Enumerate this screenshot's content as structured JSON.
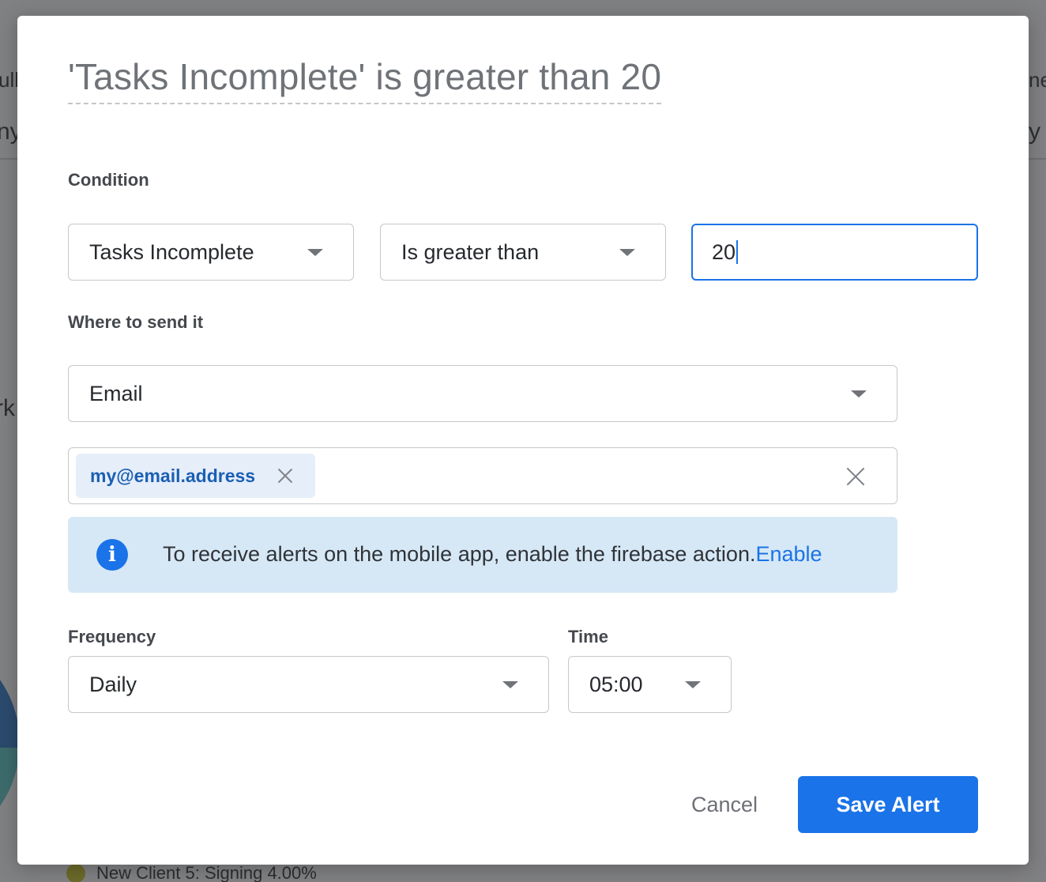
{
  "background": {
    "fragments": [
      "ull",
      "ny",
      "rk",
      "ne",
      "y"
    ],
    "legend_item": "New Client 5: Signing 4.00%"
  },
  "dialog": {
    "title": "'Tasks Incomplete' is greater than 20",
    "condition": {
      "label": "Condition",
      "metric_value": "Tasks Incomplete",
      "operator_value": "Is greater than",
      "threshold_value": "20"
    },
    "destination": {
      "label": "Where to send it",
      "channel_value": "Email",
      "recipients": [
        "my@email.address"
      ]
    },
    "notice": {
      "text": "To receive alerts on the mobile app, enable the firebase action.",
      "link_label": "Enable"
    },
    "schedule": {
      "frequency_label": "Frequency",
      "frequency_value": "Daily",
      "time_label": "Time",
      "time_value": "05:00"
    },
    "actions": {
      "cancel_label": "Cancel",
      "save_label": "Save Alert"
    }
  },
  "colors": {
    "accent": "#1a73e8",
    "notice_bg": "#d6e8f6",
    "chip_bg": "#e6eef9",
    "overlay": "#808183"
  },
  "icons": {
    "dropdown": "chevron-down-icon",
    "remove_chip": "close-icon",
    "clear_all": "close-icon",
    "notice": "info-icon"
  }
}
